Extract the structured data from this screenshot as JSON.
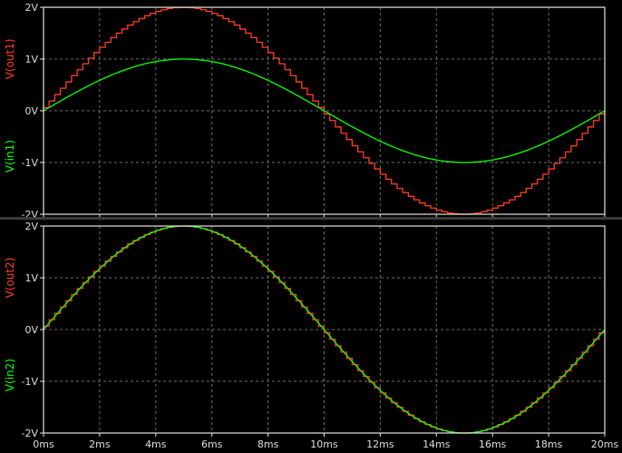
{
  "chart_data": [
    {
      "type": "line",
      "title": "",
      "xlabel": "",
      "xlim": [
        0,
        20
      ],
      "ylim": [
        -2,
        2
      ],
      "x_ticks": [
        "0ms",
        "2ms",
        "4ms",
        "6ms",
        "8ms",
        "10ms",
        "12ms",
        "14ms",
        "16ms",
        "18ms",
        "20ms"
      ],
      "y_ticks": [
        "2V",
        "1V",
        "0V",
        "-1V",
        "-2V"
      ],
      "grid": true,
      "x_unit": "ms",
      "y_unit": "V",
      "series": [
        {
          "name": "V(out1)",
          "color": "#ff3b1f",
          "style": "staircase",
          "amplitude": 2,
          "frequency_hz": 50,
          "step_ms": 0.2
        },
        {
          "name": "V(in1)",
          "color": "#00ff00",
          "style": "smooth",
          "amplitude": 1,
          "frequency_hz": 50
        }
      ]
    },
    {
      "type": "line",
      "title": "",
      "xlabel": "",
      "xlim": [
        0,
        20
      ],
      "ylim": [
        -2,
        2
      ],
      "x_ticks": [
        "0ms",
        "2ms",
        "4ms",
        "6ms",
        "8ms",
        "10ms",
        "12ms",
        "14ms",
        "16ms",
        "18ms",
        "20ms"
      ],
      "y_ticks": [
        "2V",
        "1V",
        "0V",
        "-1V",
        "-2V"
      ],
      "grid": true,
      "x_unit": "ms",
      "y_unit": "V",
      "series": [
        {
          "name": "V(out2)",
          "color": "#ff3b1f",
          "style": "staircase",
          "amplitude": 2,
          "frequency_hz": 50,
          "step_ms": 0.2
        },
        {
          "name": "V(in2)",
          "color": "#00ff00",
          "style": "smooth",
          "amplitude": 2,
          "frequency_hz": 50
        }
      ]
    }
  ],
  "colors": {
    "background": "#000000",
    "frame": "#e0e0e0",
    "grid": "#6a6a6a",
    "text": "#d8d8d8"
  }
}
